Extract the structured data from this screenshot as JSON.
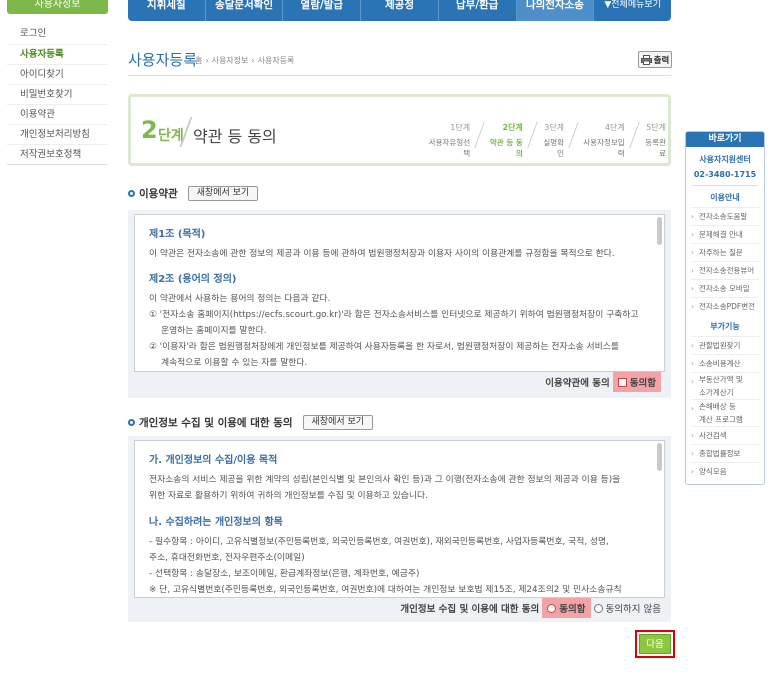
{
  "lnb": {
    "title": "사용자정보",
    "items": [
      "로그인",
      "사용자등록",
      "아이디찾기",
      "비밀번호찾기",
      "이용약관",
      "개인정보처리방침",
      "저작권보호정책"
    ],
    "active_index": 1
  },
  "gnb": {
    "items": [
      "지휘세칠",
      "송달문서확인",
      "열람/발급",
      "제공정",
      "납부/환급",
      "나의전자소송",
      "▼전체메뉴보기"
    ]
  },
  "header": {
    "title": "사용자등록",
    "breadcrumb": [
      "홈",
      "사용자정보",
      "사용자등록"
    ],
    "print_label": "출력"
  },
  "stepbox": {
    "num": "2",
    "unit": "단계",
    "name": "약관 등 동의",
    "steps": [
      {
        "n": "1단계",
        "t": "사용자유형선택"
      },
      {
        "n": "2단계",
        "t": "약관 등 동의"
      },
      {
        "n": "3단계",
        "t": "실명확인"
      },
      {
        "n": "4단계",
        "t": "사용자정보입력"
      },
      {
        "n": "5단계",
        "t": "등록완료"
      }
    ]
  },
  "terms": {
    "title": "이용약관",
    "newwin": "새창에서 보기",
    "art1_title": "제1조 (목적)",
    "art1_text": "이 약관은 전자소송에 관한 정보의 제공과 이용 등에 관하여 법원행정처장과 이용자 사이의 이용관계를 규정함을 목적으로 한다.",
    "art2_title": "제2조 (용어의 정의)",
    "art2_text": "이 약관에서 사용하는 용어의 정의는 다음과 같다.",
    "art2_item1a": "① '전자소송 홈페이지(https://ecfs.scourt.go.kr)'라 함은 전자소송서비스를 인터넷으로 제공하기 위하여 법원행정처장이 구축하고",
    "art2_item1b": "운영하는 홈페이지를 말한다.",
    "art2_item2a": "② '이용자'라 함은 법원행정처장에게 개인정보를 제공하여 사용자등록을 한 자로서, 법원행정처장이 제공하는 전자소송 서비스를",
    "art2_item2b": "계속적으로 이용할 수 있는 자를 말한다.",
    "agree_label": "이용약관에 동의",
    "agree_check": "동의함"
  },
  "privacy": {
    "title": "개인정보 수집 및 이용에 대한 동의",
    "newwin": "새창에서 보기",
    "h1": "가. 개인정보의 수집/이용 목적",
    "p1a": "전자소송의 서비스 제공을 위한 계약의 성립(본인식별 및 본인의사 확인 등)과 그 이행(전자소송에 관한 정보의 제공과 이용 등)을",
    "p1b": "위한 자료로 활용하기 위하여 귀하의 개인정보를 수집 및 이용하고 있습니다.",
    "h2": "나. 수집하려는 개인정보의 항목",
    "p2a": "- 필수항목 : 아이디, 고유식별정보(주민등록번호, 외국인등록번호, 여권번호), 재외국민등록번호, 사업자등록번호, 국적, 성명,",
    "p2b": "주소, 휴대전화번호, 전자우편주소(이메일)",
    "p2c": "- 선택항목 : 송달장소, 보조이메일, 환급계좌정보(은행, 계좌번호, 예금주)",
    "p2d": "※ 단, 고유식별번호(주민등록번호, 외국인등록번호, 여권번호)에 대하여는 개인정보 보호법 제15조, 제24조의2 및 민사소송규칙",
    "agree_label": "개인정보 수집 및 이용에 대한 동의",
    "agree_yes": "동의함",
    "agree_no": "동의하지 않음"
  },
  "next_label": "다음",
  "quick": {
    "title": "바로가기",
    "center": "사용자지원센터",
    "tel": "02-3480-1715",
    "sub1": "이용안내",
    "items1": [
      "전자소송도움말",
      "문제해결 안내",
      "자주하는 질문",
      "전자소송전용뷰어",
      "전자소송 모바일",
      "전자소송PDF변전"
    ],
    "sub2": "부가기능",
    "items2": [
      "관할법원찾기",
      "소송비용계산",
      "부동산가액 및",
      "소가계산기",
      "손해배상 등",
      "계산 프로그램",
      "사건검색",
      "종합법률정보",
      "양식모음"
    ]
  }
}
